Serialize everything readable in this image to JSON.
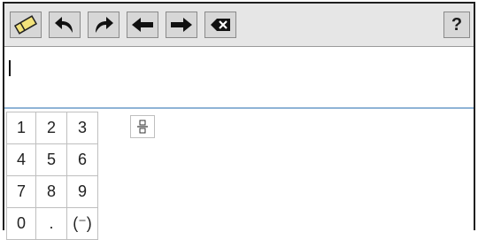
{
  "toolbar": {
    "buttons": [
      {
        "name": "eraser-button",
        "icon": "eraser-icon"
      },
      {
        "name": "undo-button",
        "icon": "undo-icon"
      },
      {
        "name": "redo-button",
        "icon": "redo-icon"
      },
      {
        "name": "cursor-left-button",
        "icon": "arrow-left-icon"
      },
      {
        "name": "cursor-right-button",
        "icon": "arrow-right-icon"
      },
      {
        "name": "backspace-button",
        "icon": "backspace-icon"
      }
    ],
    "help_label": "?"
  },
  "input": {
    "value": ""
  },
  "keypad": {
    "keys": [
      "1",
      "2",
      "3",
      "4",
      "5",
      "6",
      "7",
      "8",
      "9",
      "0",
      ".",
      "(⁻)"
    ]
  },
  "fraction_button": {
    "icon": "fraction-template-icon"
  },
  "colors": {
    "toolbar_bg": "#e6e6e6",
    "button_bg": "#d7d7d7",
    "input_underline": "#8fb3d6"
  }
}
